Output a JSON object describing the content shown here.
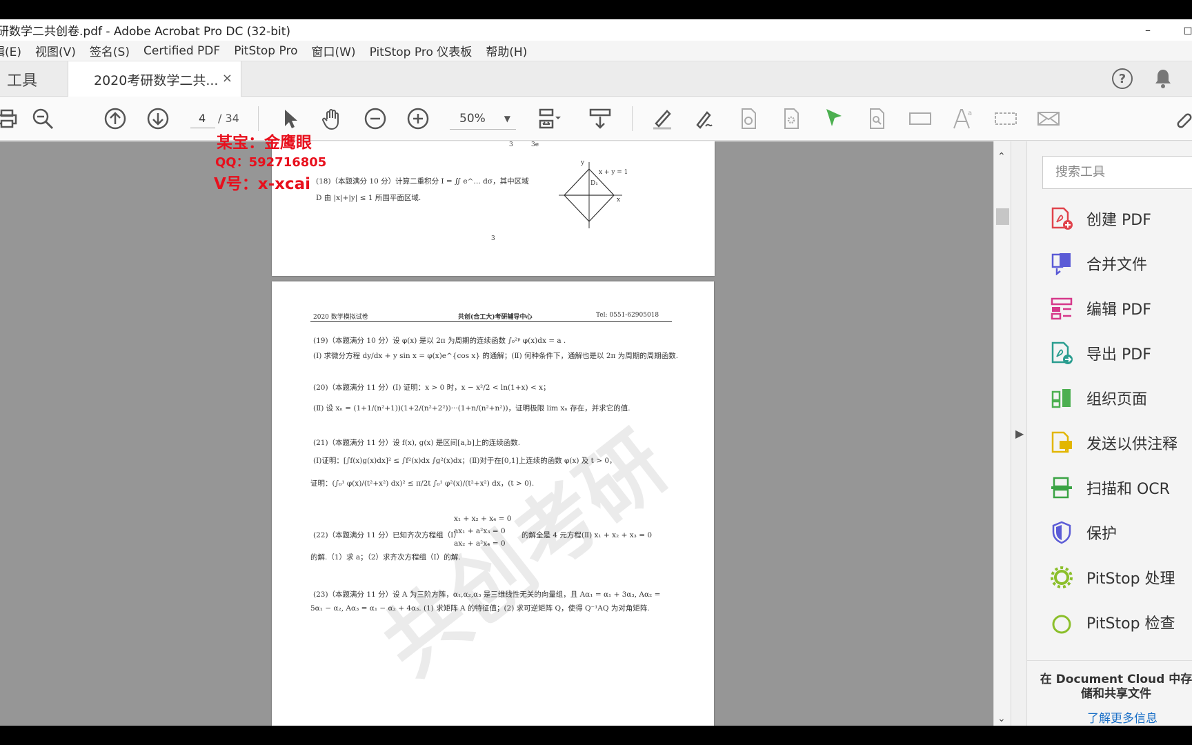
{
  "window": {
    "title": "研数学二共创卷.pdf - Adobe Acrobat Pro DC (32-bit)",
    "minimize": "–",
    "maximize": "◻"
  },
  "menu": [
    "辑(E)",
    "视图(V)",
    "签名(S)",
    "Certified PDF",
    "PitStop Pro",
    "窗口(W)",
    "PitStop Pro 仪表板",
    "帮助(H)"
  ],
  "tabs": {
    "tools": "工具",
    "document": "2020考研数学二共...",
    "close": "×",
    "help": "?"
  },
  "toolbar": {
    "page_current": "4",
    "page_total": "/ 34",
    "zoom": "50%",
    "zoom_caret": "▼"
  },
  "overlay": {
    "line1": "某宝：金鹰眼",
    "line2": "QQ：592716805",
    "line3": "V号：x-xcai"
  },
  "page1": {
    "q18": "(18)（本题满分 10 分）计算二重积分 I = ∬ e^… dσ，其中区域",
    "q18b": "D 由 |x|+|y| ≤ 1 所围平面区域.",
    "fig_eq": "x + y = 1",
    "fig_y": "y",
    "fig_x": "x",
    "fig_d": "D₁",
    "top_frag_a": "3",
    "top_frag_b": "3e",
    "page_no": "3"
  },
  "page2": {
    "header_left": "2020 数学模拟试卷",
    "header_center": "共创(合工大)考研辅导中心",
    "header_right": "Tel:   0551-62905018",
    "q19a": "(19)（本题满分 10 分）设 φ(x) 是以 2π 为周期的连续函数 ∫₀²ᵖ φ(x)dx = a .",
    "q19b": "(Ⅰ) 求微分方程 dy/dx + y sin x = φ(x)e^{cos x} 的通解；(Ⅱ) 何种条件下，通解也是以 2π 为周期的周期函数.",
    "q20a": "(20)（本题满分 11 分）(Ⅰ) 证明：x > 0 时，x − x²/2 < ln(1+x) < x；",
    "q20b": "(Ⅱ) 设 xₙ = (1+1/(n²+1))(1+2/(n²+2²))···(1+n/(n²+n²))，证明极限 lim xₙ 存在，并求它的值.",
    "q21a": "(21)（本题满分 11 分）设 f(x), g(x) 是区间[a,b]上的连续函数.",
    "q21b": "(Ⅰ)证明：[∫f(x)g(x)dx]² ≤ ∫f²(x)dx ∫g²(x)dx；(Ⅱ)对于在[0,1]上连续的函数 φ(x) 及 t > 0，",
    "q21c": "证明：(∫₀¹ φ(x)/(t²+x²) dx)² ≤ π/2t ∫₀¹ φ²(x)/(t²+x²) dx，(t > 0).",
    "q22sys1": "x₁ + x₂ + x₄ = 0",
    "q22sys2": "ax₁ + a²x₃ = 0",
    "q22sys3": "ax₂ + a²x₄ = 0",
    "q22a": "(22)（本题满分 11 分）已知齐次方程组（Ⅰ）",
    "q22a2": "的解全是 4 元方程(Ⅱ) x₁ + x₂ + x₃ = 0",
    "q22b": "的解.（1）求 a；（2）求齐次方程组（Ⅰ）的解.",
    "q23a": "(23)（本题满分 11 分）设 A 为三阶方阵，α₁,α₂,α₃ 是三维线性无关的向量组，且 Aα₁ = α₁ + 3α₃, Aα₂ =",
    "q23b": "5α₁ − α₂, Aα₃ = α₁ − α₂ + 4α₃. (1) 求矩阵 A 的特征值；(2) 求可逆矩阵 Q，使得 Q⁻¹AQ 为对角矩阵.",
    "watermark": "共创考研"
  },
  "tools_pane": {
    "search_placeholder": "搜索工具",
    "items": [
      {
        "label": "创建 PDF",
        "color": "#e0434c"
      },
      {
        "label": "合并文件",
        "color": "#5b5bd6"
      },
      {
        "label": "编辑 PDF",
        "color": "#d6388a"
      },
      {
        "label": "导出 PDF",
        "color": "#2a9d8f"
      },
      {
        "label": "组织页面",
        "color": "#4caf50"
      },
      {
        "label": "发送以供注释",
        "color": "#e2b600"
      },
      {
        "label": "扫描和 OCR",
        "color": "#3aa344"
      },
      {
        "label": "保护",
        "color": "#5b5bd6"
      },
      {
        "label": "PitStop 处理",
        "color": "#8bbf2a"
      },
      {
        "label": "PitStop 检查",
        "color": "#8bbf2a"
      }
    ],
    "dc_title": "在 Document Cloud 中存储和共享文件",
    "dc_link": "了解更多信息"
  },
  "scroll": {
    "up": "⌃",
    "down": "⌄",
    "pane_arrow": "▶"
  },
  "colors": {
    "accent_green": "#4caf50",
    "overlay_red": "#e8101d"
  }
}
